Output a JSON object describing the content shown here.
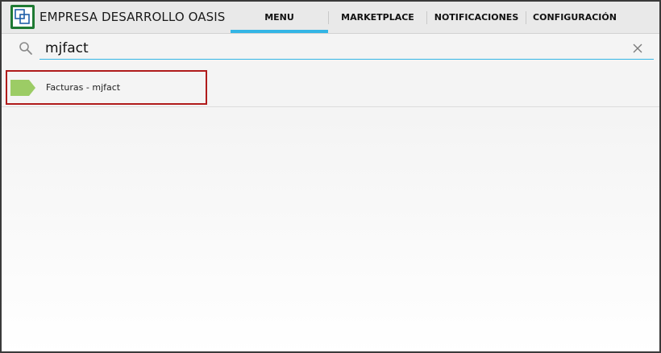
{
  "header": {
    "company_name": "EMPRESA DESARROLLO OASIS",
    "logo_icon": "app-logo-icon",
    "tabs": [
      {
        "label": "MENU",
        "active": true
      },
      {
        "label": "MARKETPLACE",
        "active": false
      },
      {
        "label": "NOTIFICACIONES",
        "active": false
      },
      {
        "label": "CONFIGURACIÓN",
        "active": false
      }
    ]
  },
  "search": {
    "value": "mjfact",
    "icon": "search-icon",
    "clear_icon": "close-icon"
  },
  "results": [
    {
      "label": "Facturas - mjfact",
      "icon": "tag-icon",
      "icon_color": "#9ccc65",
      "selected": true
    }
  ],
  "colors": {
    "accent": "#33b5e5",
    "selection_border": "#b01b1b",
    "logo_green": "#1f7a33",
    "tag_green": "#9ccc65"
  }
}
